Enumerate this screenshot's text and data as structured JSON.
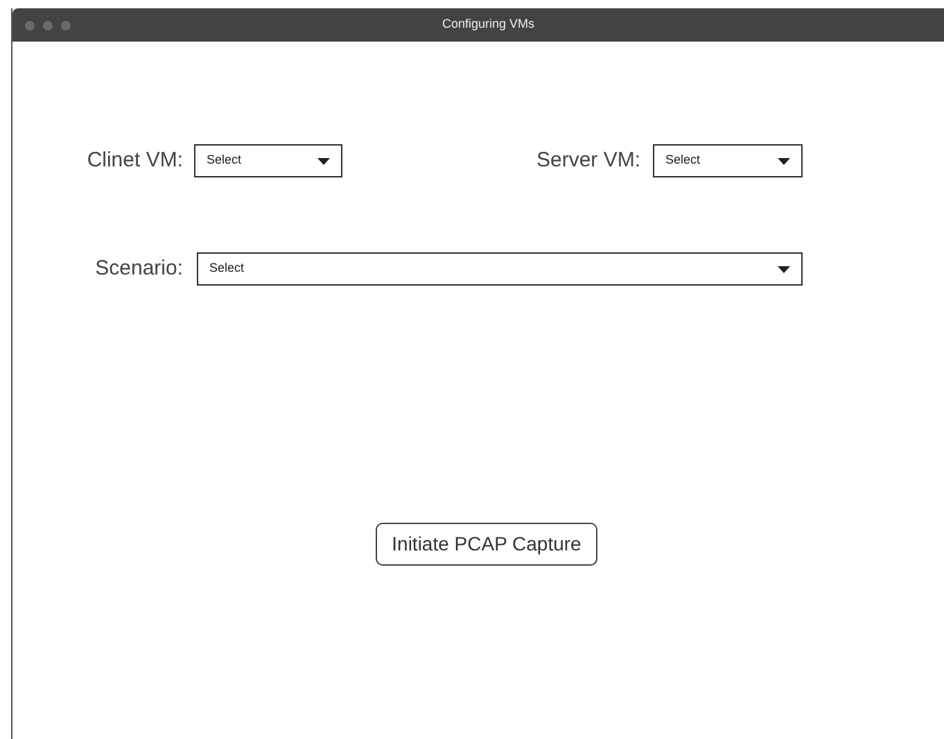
{
  "window": {
    "title": "Configuring VMs"
  },
  "fields": [
    {
      "label": "Clinet VM:",
      "value": "Select"
    },
    {
      "label": "Server VM:",
      "value": "Select"
    },
    {
      "label": "Scenario:",
      "value": "Select"
    }
  ],
  "button": "Initiate PCAP Capture"
}
